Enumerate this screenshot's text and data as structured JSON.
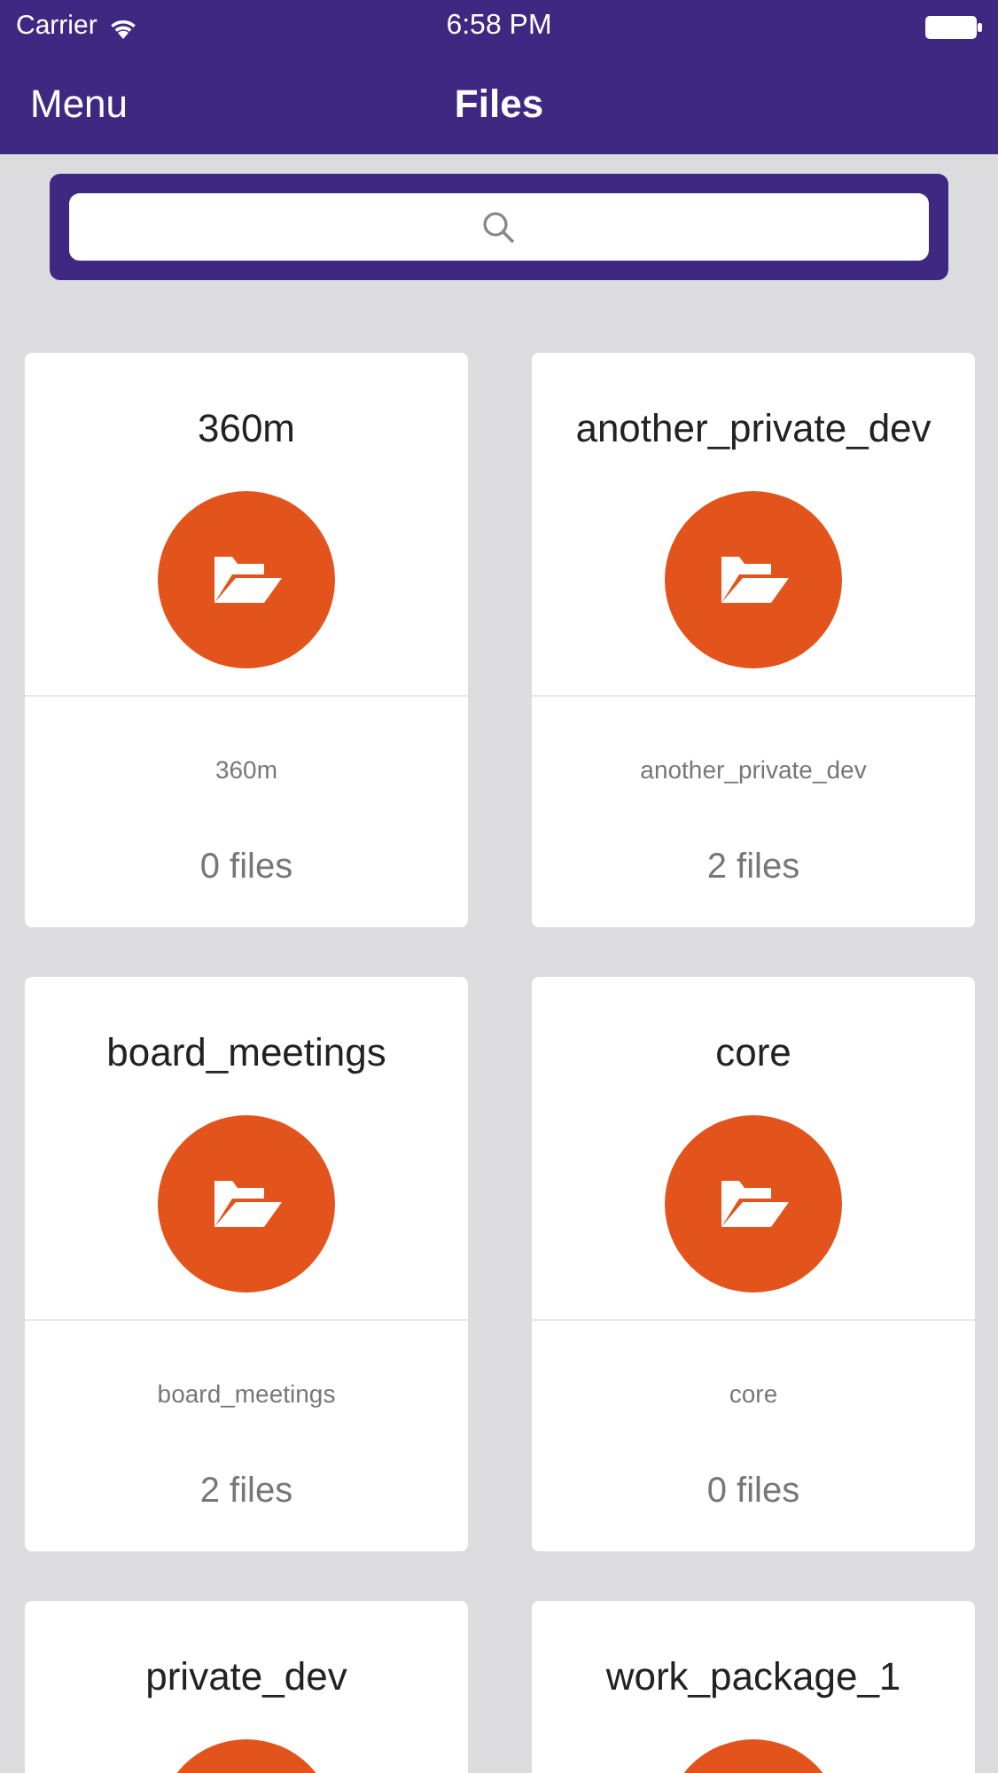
{
  "status_bar": {
    "carrier": "Carrier",
    "time": "6:58 PM"
  },
  "nav_bar": {
    "left": "Menu",
    "title": "Files"
  },
  "folders": [
    {
      "title": "360m",
      "name": "360m",
      "count": "0 files"
    },
    {
      "title": "another_private_dev",
      "name": "another_private_dev",
      "count": "2 files"
    },
    {
      "title": "board_meetings",
      "name": "board_meetings",
      "count": "2 files"
    },
    {
      "title": "core",
      "name": "core",
      "count": "0 files"
    },
    {
      "title": "private_dev"
    },
    {
      "title": "work_package_1"
    }
  ]
}
